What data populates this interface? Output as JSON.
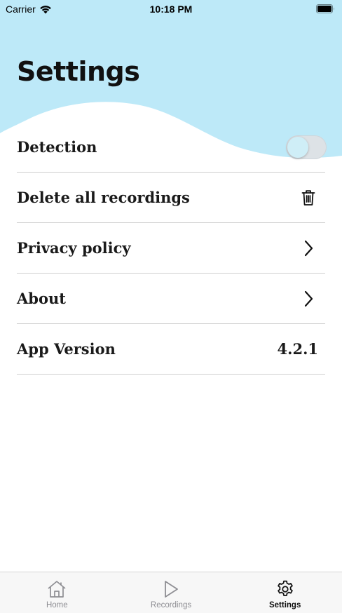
{
  "status_bar": {
    "carrier": "Carrier",
    "time": "10:18 PM",
    "wifi_icon": "wifi-icon",
    "battery_icon": "battery-icon"
  },
  "header": {
    "title": "Settings",
    "background_color": "#bde9f8"
  },
  "settings": {
    "items": [
      {
        "label": "Detection",
        "control": "toggle",
        "toggle_on": false
      },
      {
        "label": "Delete all recordings",
        "icon": "trash-icon"
      },
      {
        "label": "Privacy policy",
        "icon": "chevron-right-icon"
      },
      {
        "label": "About",
        "icon": "chevron-right-icon"
      },
      {
        "label": "App Version",
        "value": "4.2.1"
      }
    ]
  },
  "tab_bar": {
    "tabs": [
      {
        "label": "Home",
        "icon": "home-icon",
        "active": false
      },
      {
        "label": "Recordings",
        "icon": "play-icon",
        "active": false
      },
      {
        "label": "Settings",
        "icon": "gear-icon",
        "active": true
      }
    ]
  }
}
